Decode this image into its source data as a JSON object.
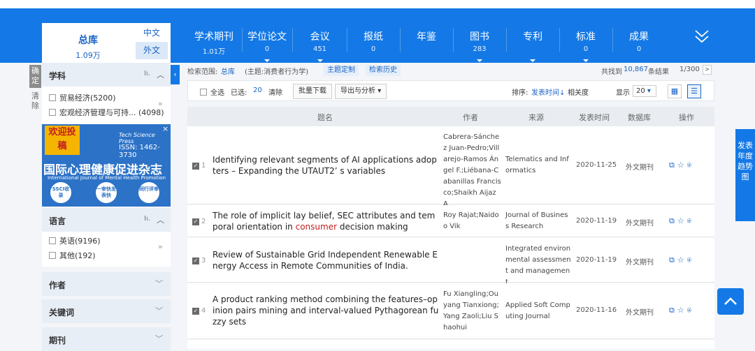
{
  "header": {
    "zongku": {
      "label": "总库",
      "count": "1.09万"
    },
    "lang": {
      "cn": "中文",
      "en": "外文"
    },
    "tabs": [
      {
        "label": "学术期刊",
        "count": "1.01万"
      },
      {
        "label": "学位论文",
        "count": "0"
      },
      {
        "label": "会议",
        "count": "451"
      },
      {
        "label": "报纸",
        "count": "0"
      },
      {
        "label": "年鉴",
        "count": ""
      },
      {
        "label": "图书",
        "count": "283"
      },
      {
        "label": "专利",
        "count": ""
      },
      {
        "label": "标准",
        "count": "0"
      },
      {
        "label": "成果",
        "count": "0"
      }
    ],
    "expand_icon": "double-chevron-down-icon"
  },
  "sidebar": {
    "confirm_label": "确定",
    "clear_label": "清除",
    "subject": {
      "title": "学科",
      "items": [
        {
          "label": "贸易经济(5200)"
        },
        {
          "label": "宏观经济管理与可持...",
          "count": "(4098)"
        }
      ]
    },
    "ad": {
      "badge": "欢迎投稿",
      "publisher": "Tech Science Press",
      "issn": "ISSN: 1462-3730",
      "journal_cn": "国际心理健康促进杂志",
      "journal_en": "International Journal of Mental Health Promotion",
      "circles": [
        "SSCI收录",
        "一审快发表快",
        "同行评审"
      ],
      "close": "×"
    },
    "language": {
      "title": "语言",
      "items": [
        {
          "label": "英语(9196)"
        },
        {
          "label": "其他(192)"
        }
      ]
    },
    "collapsed": [
      {
        "title": "作者"
      },
      {
        "title": "关键词"
      },
      {
        "title": "期刊"
      }
    ]
  },
  "info": {
    "scope_label": "检索范围:",
    "scope_value": "总库",
    "subject_query": "(主题:消费者行为学)",
    "custom_button": "主题定制",
    "history_button": "检索历史",
    "found_prefix": "共找到",
    "found_count": "10,867",
    "found_suffix": "条结果",
    "page": "1/300",
    "next": ">"
  },
  "toolbar": {
    "select_all": "全选",
    "selected_label": "已选:",
    "selected_count": "20",
    "clear": "清除",
    "batch_download": "批量下载",
    "export": "导出与分析",
    "sort_label": "排序:",
    "sort_time": "发表时间",
    "sort_relevance": "相关度",
    "show_label": "显示",
    "show_value": "20"
  },
  "table": {
    "headers": {
      "title": "题名",
      "author": "作者",
      "source": "来源",
      "date": "发表时间",
      "db": "数据库",
      "ops": "操作"
    },
    "rows": [
      {
        "num": "1",
        "title": "Identifying relevant segments of AI applications adopters – Expanding the UTAUT2’ s variables",
        "author": "Cabrera-Sánchez Juan-Pedro;Villarejo-Ramos Ángel F.;Liébana-Cabanillas Francisco;Shaikh Aijaz A.",
        "source": "Telematics and Informatics",
        "date": "2020-11-25",
        "db": "外文期刊"
      },
      {
        "num": "2",
        "title_pre": "The role of implicit lay belief, SEC attributes and temporal orientation in ",
        "title_hl": "consumer",
        "title_post": " decision making",
        "author": "Roy Rajat;Naidoo Vik",
        "source": "Journal of Business Research",
        "date": "2020-11-19",
        "db": "外文期刊"
      },
      {
        "num": "3",
        "title": "Review of Sustainable Grid Independent Renewable Energy Access in Remote Communities of India.",
        "author": "",
        "source": "Integrated environmental assessment and management",
        "date": "2020-11-19",
        "db": "外文期刊"
      },
      {
        "num": "4",
        "title": "A product ranking method combining the features–opinion pairs mining and interval-valued Pythagorean fuzzy sets",
        "author": "Fu Xiangling;Ouyang Tianxiong;Yang Zaoli;Liu Shaohui",
        "source": "Applied Soft Computing Journal",
        "date": "2020-11-16",
        "db": "外文期刊"
      }
    ]
  },
  "trend_button": "发表年度趋势图",
  "colors": {
    "primary": "#1479e6",
    "link": "#1a63c4",
    "highlight": "#c41e1e"
  }
}
